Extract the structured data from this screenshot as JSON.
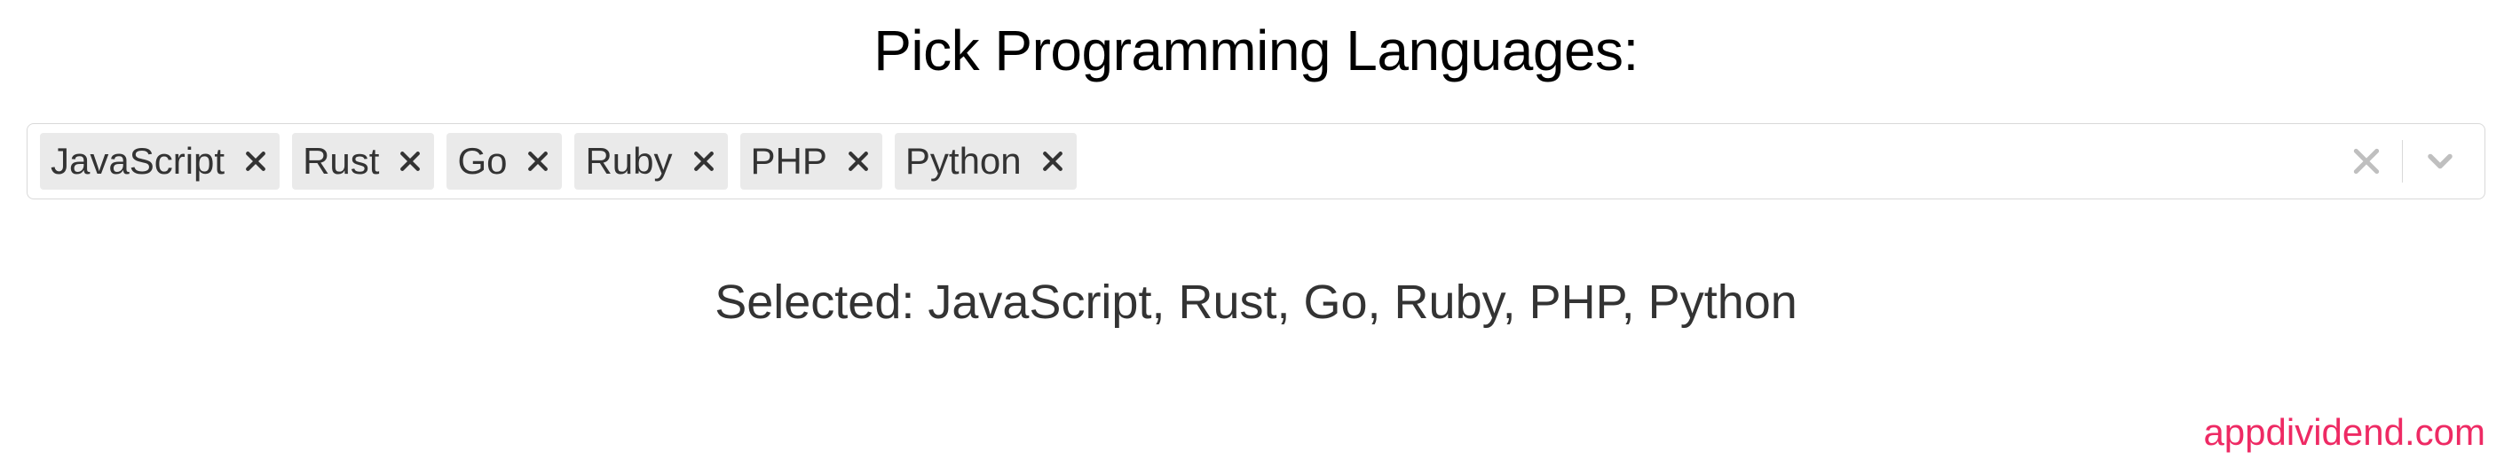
{
  "title": "Pick Programming Languages:",
  "tags": [
    {
      "label": "JavaScript"
    },
    {
      "label": "Rust"
    },
    {
      "label": "Go"
    },
    {
      "label": "Ruby"
    },
    {
      "label": "PHP"
    },
    {
      "label": "Python"
    }
  ],
  "summary_prefix": "Selected: ",
  "summary_value": "JavaScript, Rust, Go, Ruby, PHP, Python",
  "watermark": "appdividend.com"
}
